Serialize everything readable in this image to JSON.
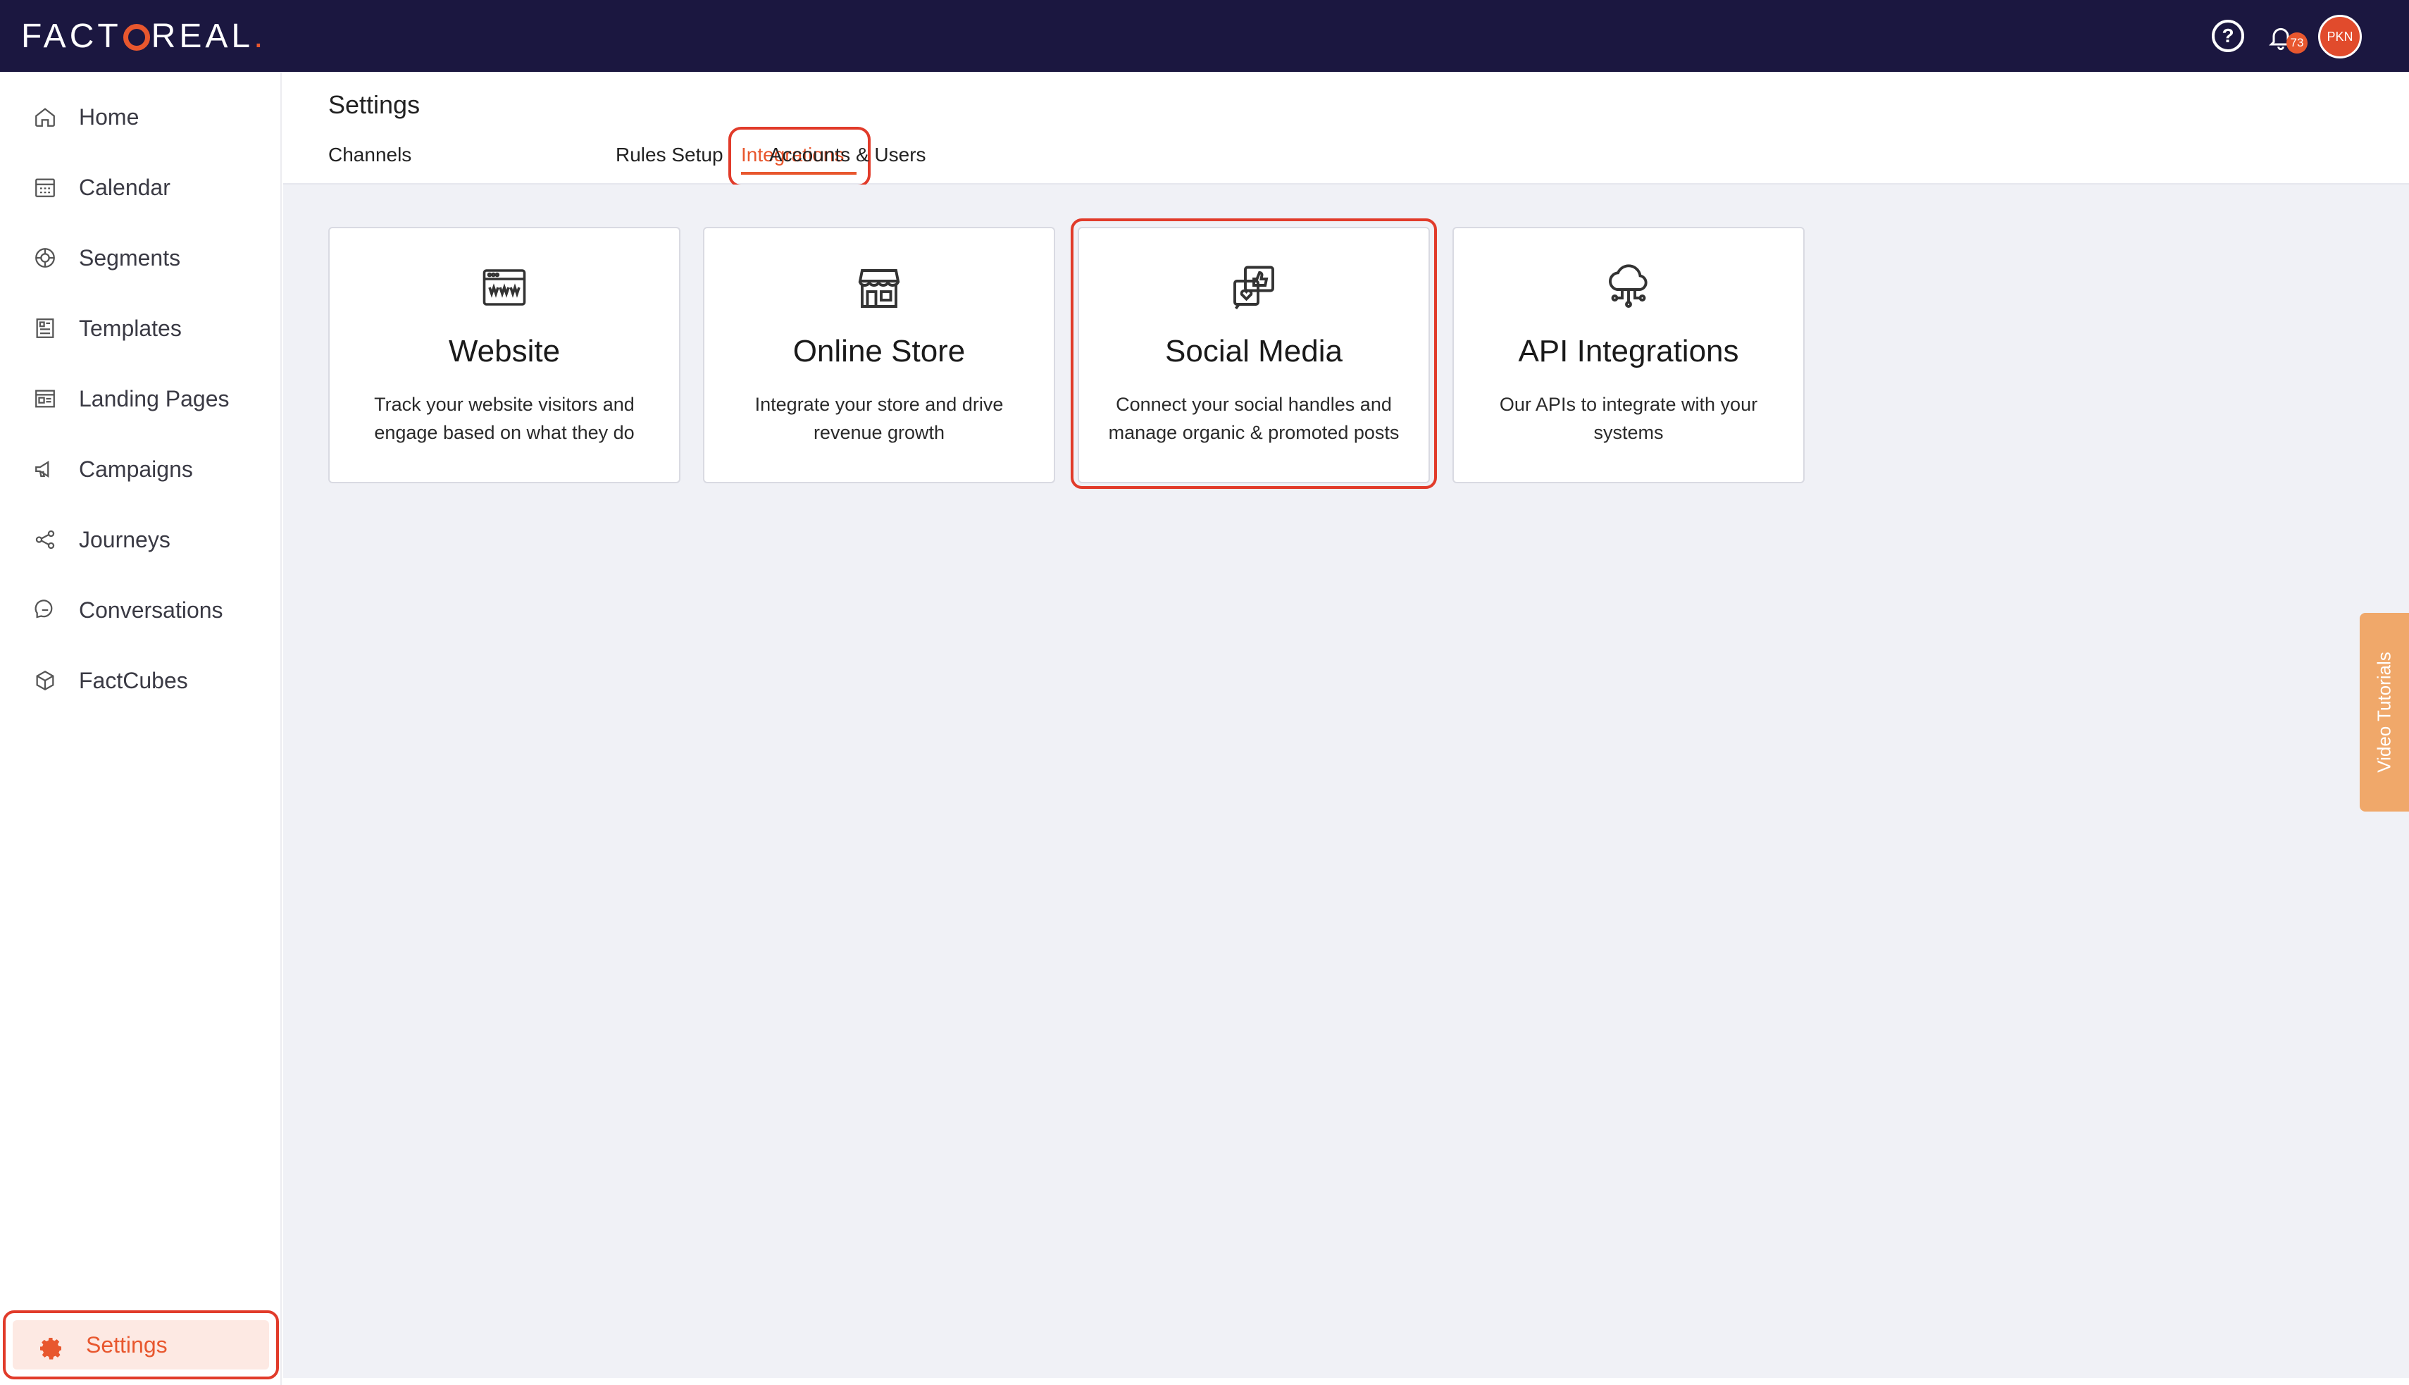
{
  "brand": {
    "logo_text": "FACTOREAL",
    "accent_color": "#e8572e",
    "header_color": "#1b1740"
  },
  "topbar": {
    "help_icon": "question-circle-icon",
    "notifications": {
      "icon": "bell-icon",
      "count": "73"
    },
    "avatar_initials": "PKN"
  },
  "sidebar": {
    "items": [
      {
        "label": "Home",
        "icon": "home-icon"
      },
      {
        "label": "Calendar",
        "icon": "calendar-icon"
      },
      {
        "label": "Segments",
        "icon": "segments-icon"
      },
      {
        "label": "Templates",
        "icon": "templates-icon"
      },
      {
        "label": "Landing Pages",
        "icon": "landing-pages-icon"
      },
      {
        "label": "Campaigns",
        "icon": "megaphone-icon"
      },
      {
        "label": "Journeys",
        "icon": "share-nodes-icon"
      },
      {
        "label": "Conversations",
        "icon": "chat-bubbles-icon"
      },
      {
        "label": "FactCubes",
        "icon": "cube-icon"
      }
    ],
    "settings": {
      "label": "Settings",
      "icon": "gear-icon",
      "active": true
    }
  },
  "main": {
    "title": "Settings",
    "tabs": [
      {
        "label": "Channels"
      },
      {
        "label": "Integrations",
        "active": true
      },
      {
        "label": "Rules Setup"
      },
      {
        "label": "Accounts & Users"
      }
    ],
    "cards": [
      {
        "title": "Website",
        "description": "Track your website visitors and engage based on what they do",
        "icon": "browser-www-icon"
      },
      {
        "title": "Online Store",
        "description": "Integrate your store and drive revenue growth",
        "icon": "storefront-icon"
      },
      {
        "title": "Social Media",
        "description": "Connect your social handles and manage organic & promoted posts",
        "icon": "social-like-heart-icon",
        "highlighted": true
      },
      {
        "title": "API Integrations",
        "description": "Our APIs to integrate with your systems",
        "icon": "cloud-network-icon"
      }
    ]
  },
  "video_tutorials": {
    "label": "Video Tutorials"
  }
}
